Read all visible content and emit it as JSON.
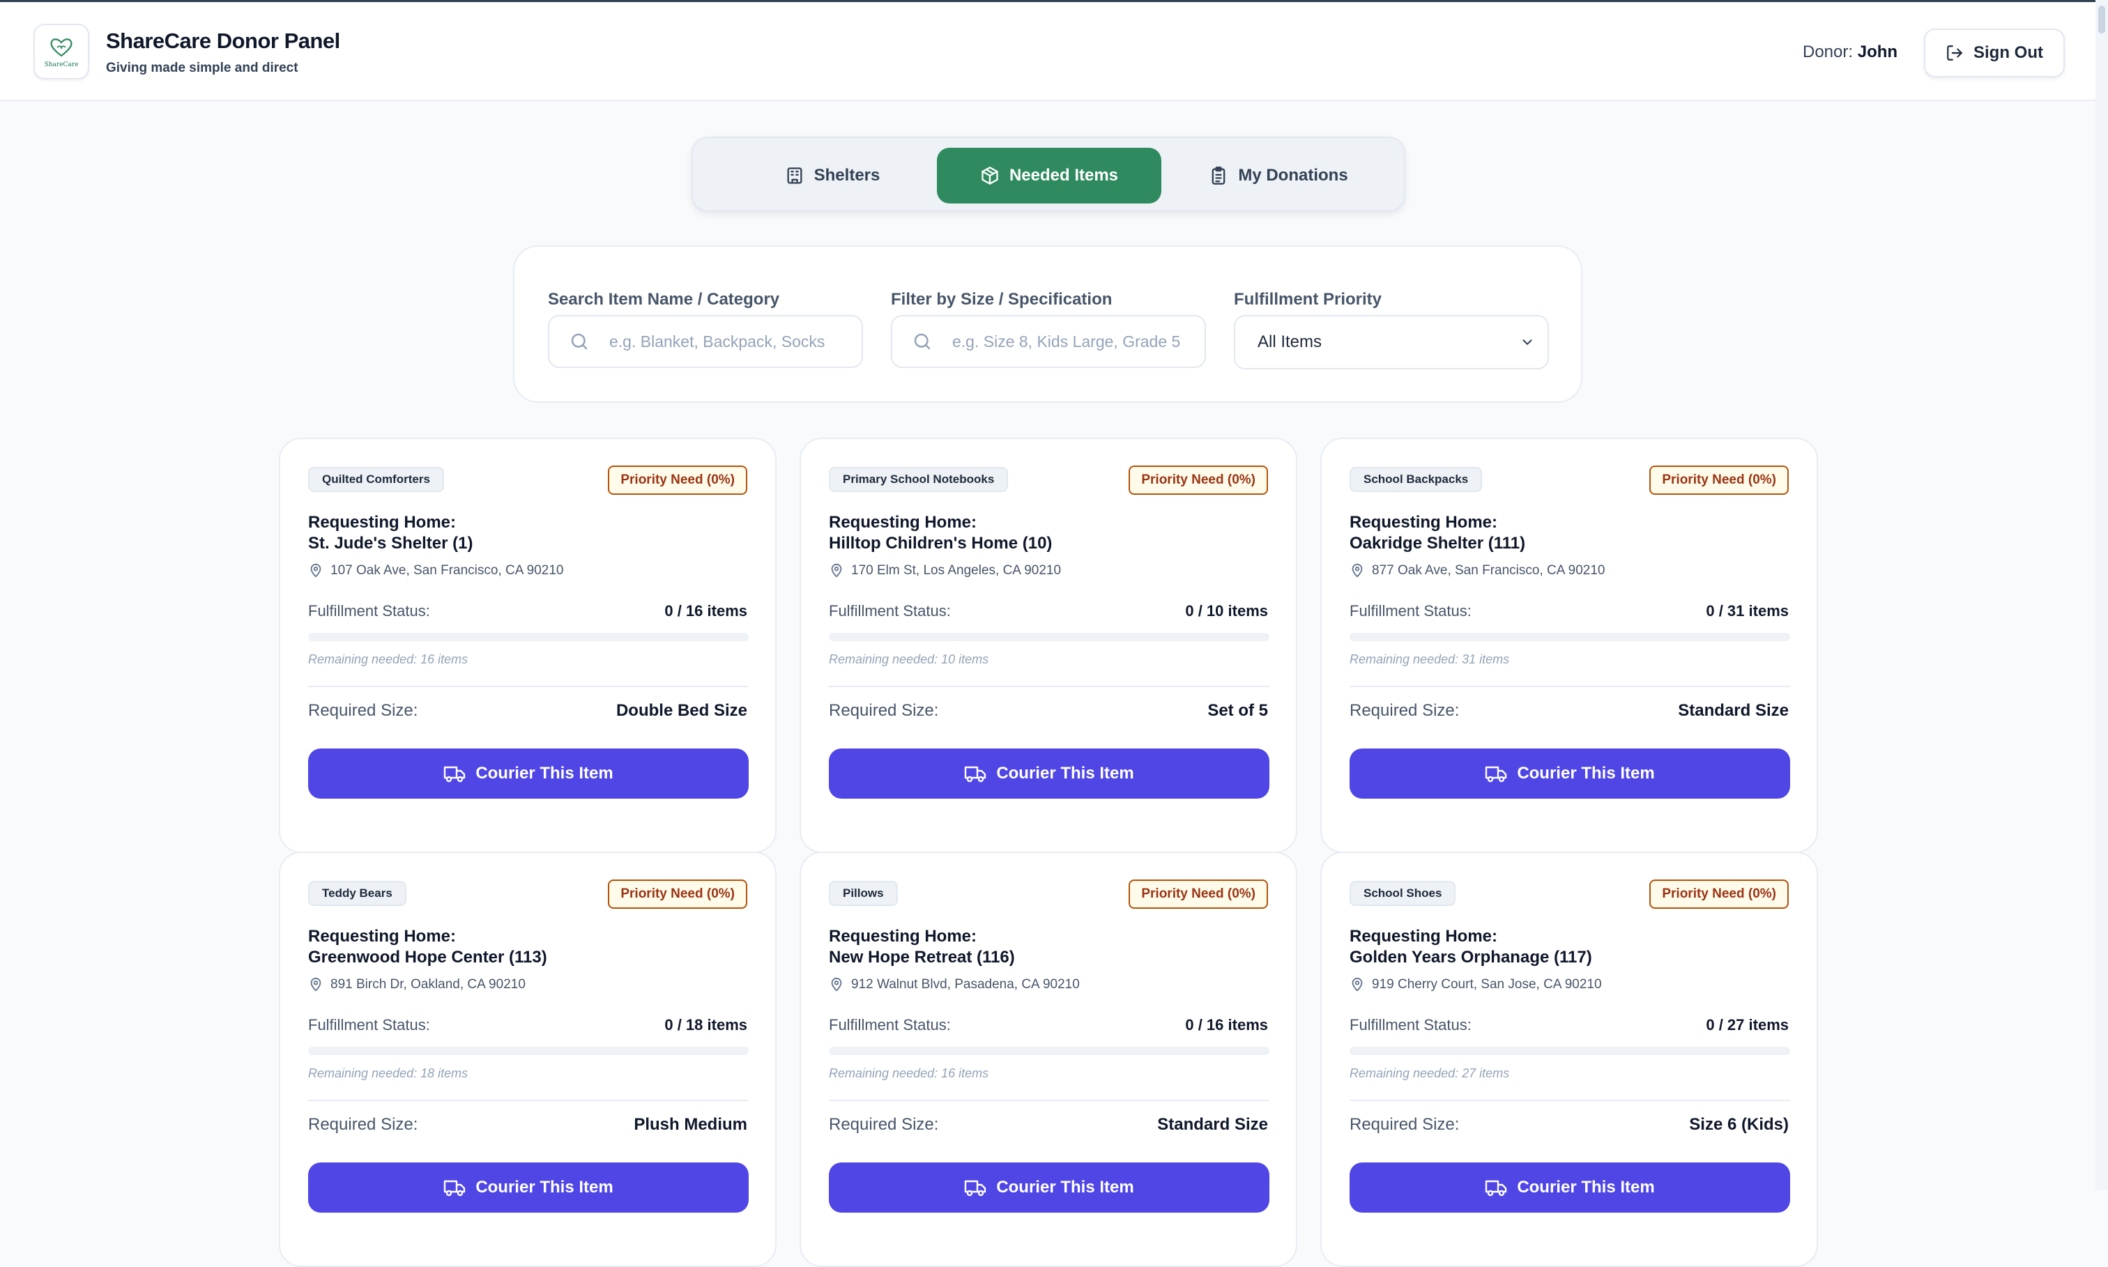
{
  "header": {
    "logo_text": "ShareCare",
    "title": "ShareCare Donor Panel",
    "subtitle": "Giving made simple and direct",
    "donor_label": "Donor:",
    "donor_name": "John",
    "sign_out": "Sign Out"
  },
  "tabs": [
    {
      "label": "Shelters",
      "icon": "building-icon",
      "active": false
    },
    {
      "label": "Needed Items",
      "icon": "package-icon",
      "active": true
    },
    {
      "label": "My Donations",
      "icon": "clipboard-icon",
      "active": false
    }
  ],
  "filters": {
    "search_label": "Search Item Name / Category",
    "search_placeholder": "e.g. Blanket, Backpack, Socks",
    "size_label": "Filter by Size / Specification",
    "size_placeholder": "e.g. Size 8, Kids Large, Grade 5",
    "priority_label": "Fulfillment Priority",
    "priority_value": "All Items"
  },
  "card_labels": {
    "requesting": "Requesting Home:",
    "fulfillment": "Fulfillment Status:",
    "required_size": "Required Size:",
    "courier": "Courier This Item"
  },
  "items": [
    {
      "category": "Quilted Comforters",
      "priority": "Priority Need (0%)",
      "home": "St. Jude's Shelter (1)",
      "address": "107 Oak Ave, San Francisco, CA 90210",
      "status": "0 / 16 items",
      "progress": 0,
      "remaining": "Remaining needed: 16 items",
      "size": "Double Bed Size"
    },
    {
      "category": "Primary School Notebooks",
      "priority": "Priority Need (0%)",
      "home": "Hilltop Children's Home (10)",
      "address": "170 Elm St, Los Angeles, CA 90210",
      "status": "0 / 10 items",
      "progress": 0,
      "remaining": "Remaining needed: 10 items",
      "size": "Set of 5"
    },
    {
      "category": "School Backpacks",
      "priority": "Priority Need (0%)",
      "home": "Oakridge Shelter (111)",
      "address": "877 Oak Ave, San Francisco, CA 90210",
      "status": "0 / 31 items",
      "progress": 0,
      "remaining": "Remaining needed: 31 items",
      "size": "Standard Size"
    },
    {
      "category": "Teddy Bears",
      "priority": "Priority Need (0%)",
      "home": "Greenwood Hope Center (113)",
      "address": "891 Birch Dr, Oakland, CA 90210",
      "status": "0 / 18 items",
      "progress": 0,
      "remaining": "Remaining needed: 18 items",
      "size": "Plush Medium"
    },
    {
      "category": "Pillows",
      "priority": "Priority Need (0%)",
      "home": "New Hope Retreat (116)",
      "address": "912 Walnut Blvd, Pasadena, CA 90210",
      "status": "0 / 16 items",
      "progress": 0,
      "remaining": "Remaining needed: 16 items",
      "size": "Standard Size"
    },
    {
      "category": "School Shoes",
      "priority": "Priority Need (0%)",
      "home": "Golden Years Orphanage (117)",
      "address": "919 Cherry Court, San Jose, CA 90210",
      "status": "0 / 27 items",
      "progress": 0,
      "remaining": "Remaining needed: 27 items",
      "size": "Size 6 (Kids)"
    }
  ]
}
